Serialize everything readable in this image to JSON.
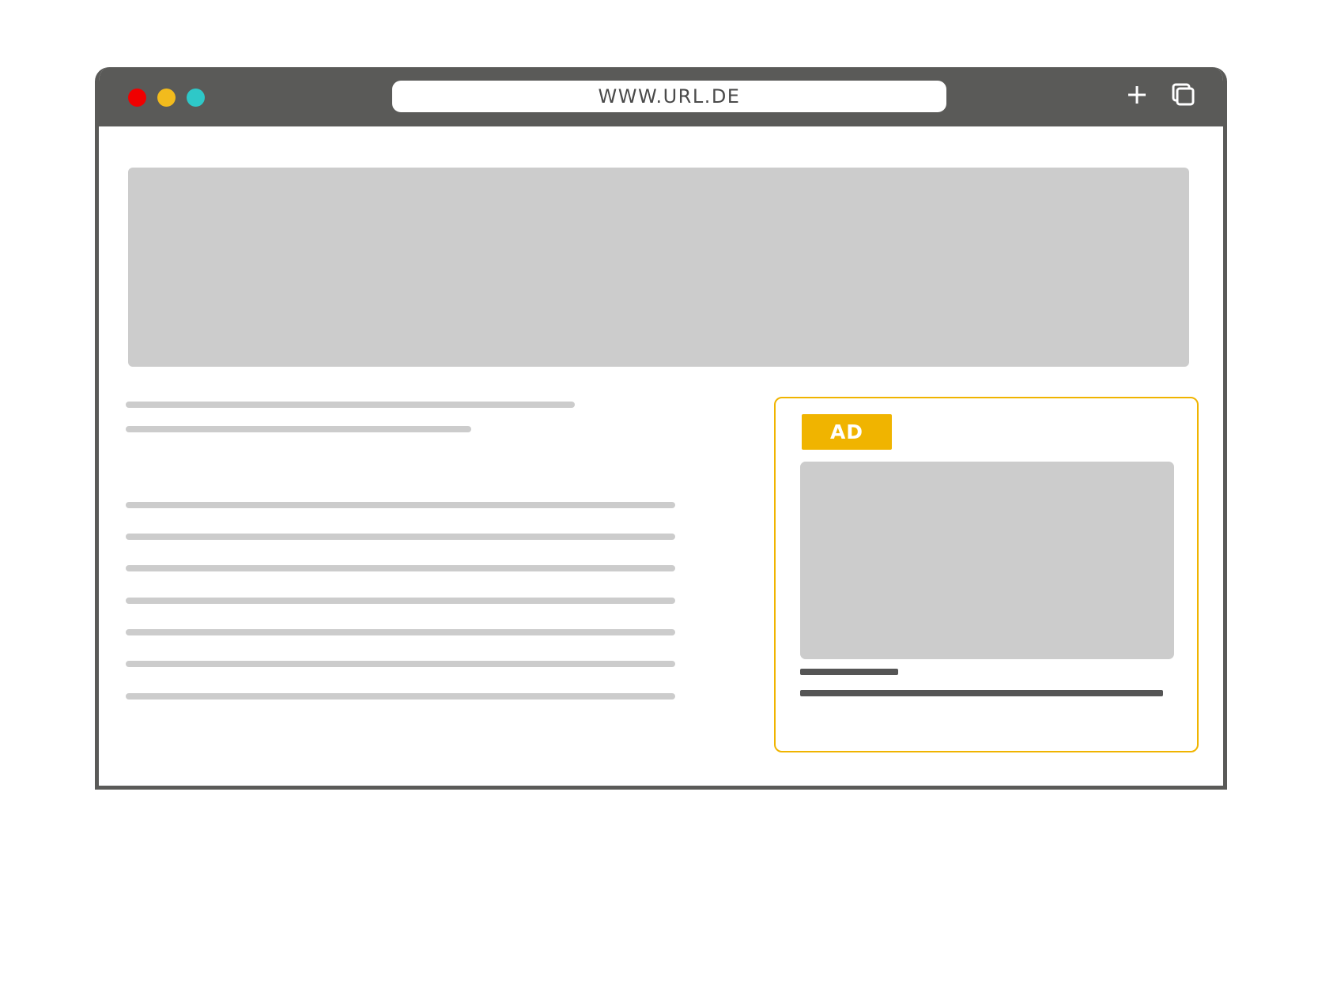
{
  "browser": {
    "url": "WWW.URL.DE",
    "window_dots": [
      {
        "name": "close",
        "color": "#f00000"
      },
      {
        "name": "minimize",
        "color": "#f2bb1d"
      },
      {
        "name": "maximize",
        "color": "#2ec8c8"
      }
    ],
    "icons": {
      "new_tab": "plus-icon",
      "tabs": "tabs-icon"
    }
  },
  "ad": {
    "badge_label": "AD",
    "accent_color": "#f0b400"
  },
  "colors": {
    "chrome": "#5a5a58",
    "placeholder": "#cccccc",
    "ad_text_lines": "#555555"
  }
}
